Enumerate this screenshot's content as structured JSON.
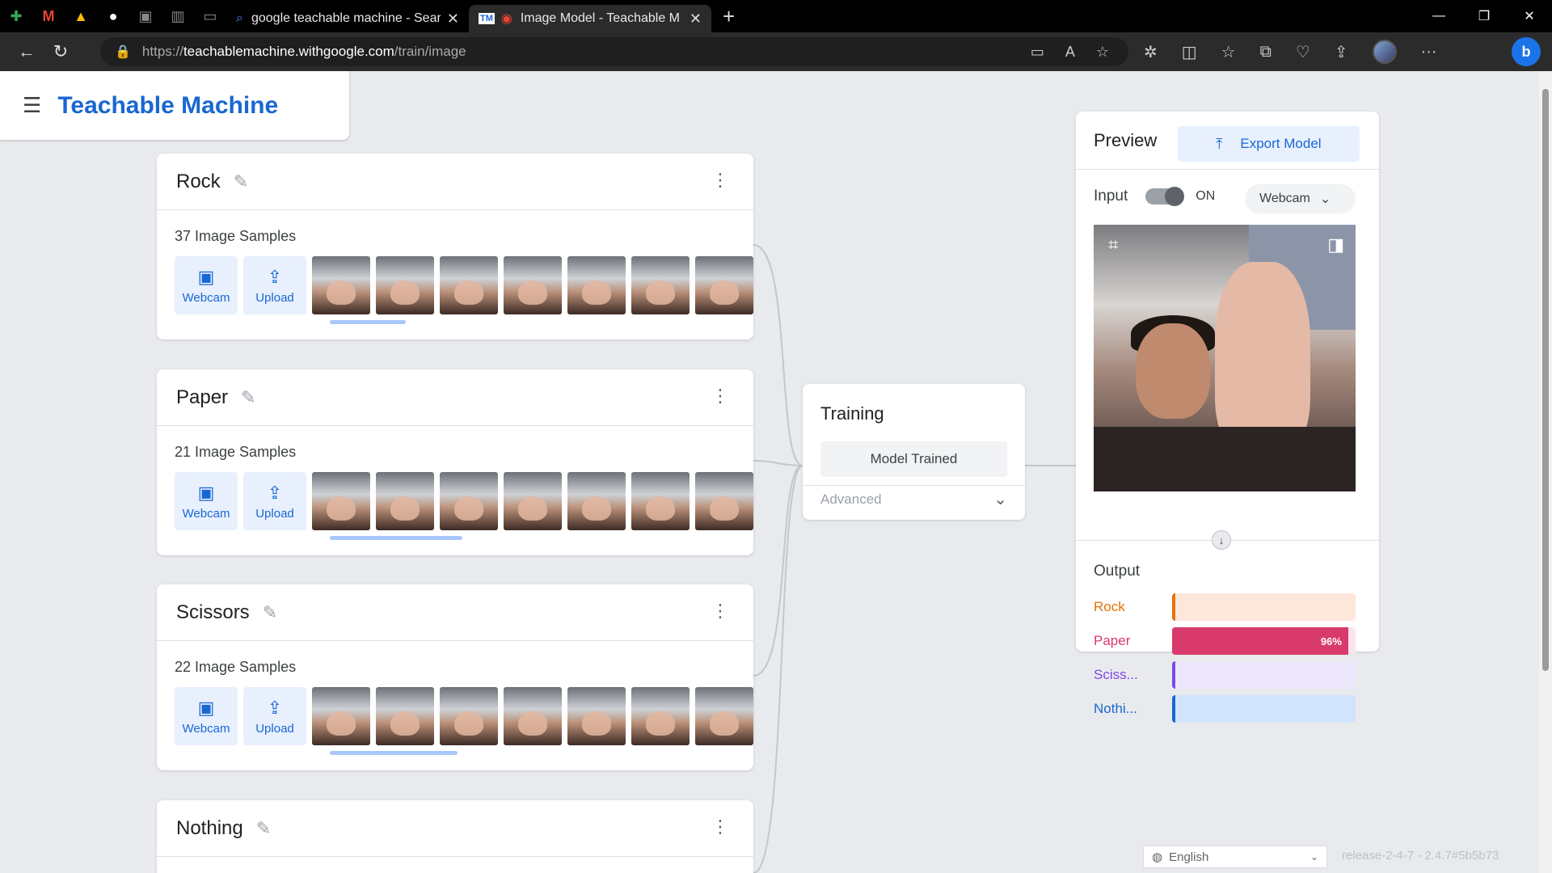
{
  "browser": {
    "tabs": [
      {
        "title": "google teachable machine - Sear",
        "icon": "search-icon",
        "active": false
      },
      {
        "title": "Image Model - Teachable M",
        "icon": "tm-icon",
        "active": true
      }
    ],
    "url_prefix": "https://",
    "url_host": "teachablemachine.withgoogle.com",
    "url_path": "/train/image"
  },
  "app": {
    "title": "Teachable Machine"
  },
  "classes": [
    {
      "name": "Rock",
      "samples": "37 Image Samples",
      "webcam_label": "Webcam",
      "upload_label": "Upload",
      "gesture": "rock"
    },
    {
      "name": "Paper",
      "samples": "21 Image Samples",
      "webcam_label": "Webcam",
      "upload_label": "Upload",
      "gesture": "paper"
    },
    {
      "name": "Scissors",
      "samples": "22 Image Samples",
      "webcam_label": "Webcam",
      "upload_label": "Upload",
      "gesture": "scissors"
    },
    {
      "name": "Nothing",
      "samples": "",
      "webcam_label": "Webcam",
      "upload_label": "Upload",
      "gesture": "nothing"
    }
  ],
  "training": {
    "title": "Training",
    "status_button": "Model Trained",
    "advanced_label": "Advanced"
  },
  "preview": {
    "title": "Preview",
    "export_label": "Export Model",
    "input_label": "Input",
    "toggle_state": "ON",
    "source": "Webcam",
    "output_title": "Output",
    "outputs": [
      {
        "label": "Rock",
        "value": 0.02,
        "color": "#e8710a",
        "track": "#fde7da",
        "text": ""
      },
      {
        "label": "Paper",
        "value": 0.96,
        "color": "#d93a6c",
        "track": "#fce4ec",
        "text": "96%"
      },
      {
        "label": "Sciss...",
        "value": 0.01,
        "color": "#7b48e8",
        "track": "#ede7fb",
        "text": ""
      },
      {
        "label": "Nothi...",
        "value": 0.01,
        "color": "#1967d2",
        "track": "#d2e3fc",
        "text": ""
      }
    ]
  },
  "footer": {
    "language": "English",
    "release": "release-2-4-7 - 2.4.7#5b5b73"
  }
}
